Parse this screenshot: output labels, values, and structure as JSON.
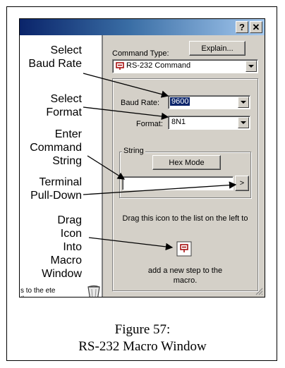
{
  "window": {
    "help_button": "?",
    "close_button": "✕"
  },
  "right_panel": {
    "command_type_label": "Command Type:",
    "explain_button": "Explain...",
    "command_type_value": "RS-232 Command",
    "baud_rate_label": "Baud Rate:",
    "baud_rate_value": "9600",
    "format_label": "Format:",
    "format_value": "8N1",
    "string_group_label": "String",
    "hex_mode_button": "Hex Mode",
    "string_value": "",
    "terminal_button": ">",
    "drag_text_top": "Drag this icon to the list on the left to",
    "drag_text_bottom": "add a new step to the macro."
  },
  "left_panel": {
    "hint_text": "s to the ete them."
  },
  "callouts": [
    "Select Baud Rate",
    "Select Format",
    "Enter Command String",
    "Terminal Pull-Down",
    "Drag Icon Into Macro Window"
  ],
  "caption": {
    "line1": "Figure 57:",
    "line2": "RS-232 Macro Window"
  }
}
